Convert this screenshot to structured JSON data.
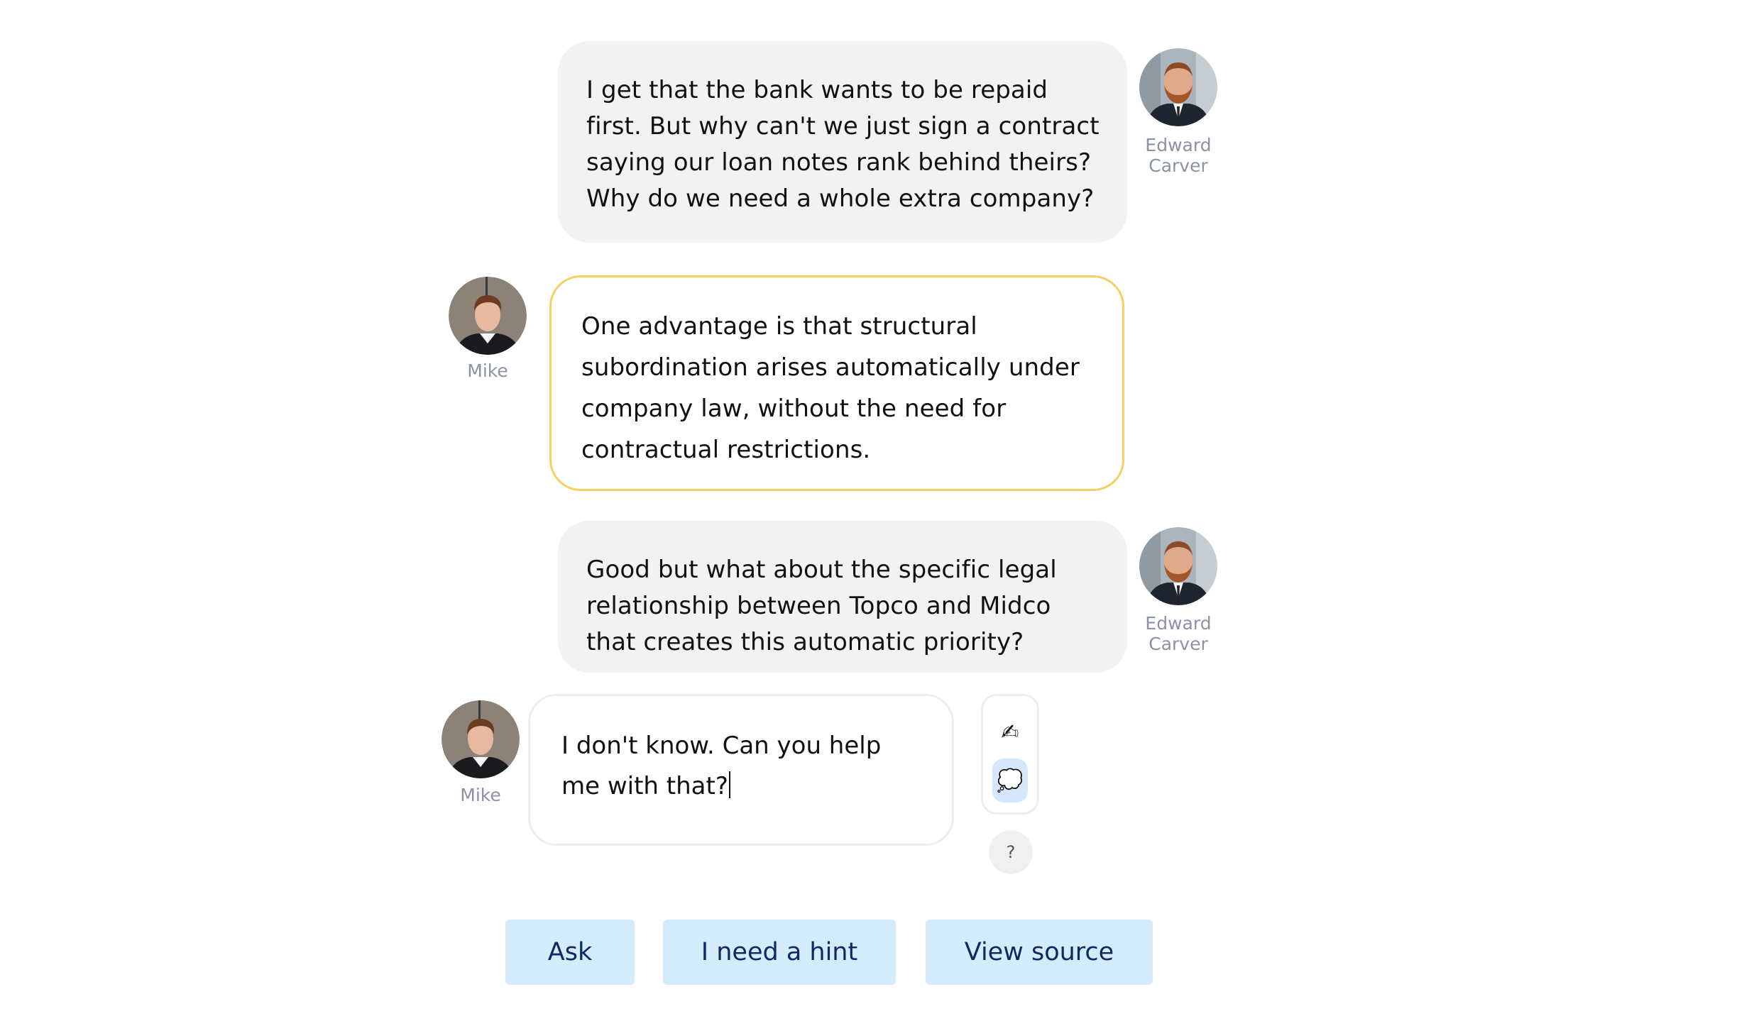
{
  "participants": {
    "interviewer": {
      "name": "Edward\nCarver",
      "name_line1": "Edward",
      "name_line2": "Carver"
    },
    "user": {
      "name": "Mike"
    }
  },
  "messages": [
    {
      "speaker": "Edward Carver",
      "text": "I get that the bank wants to be repaid first. But why can't we just sign a contract saying our loan notes rank behind theirs? Why do we need a whole extra company?"
    },
    {
      "speaker": "Mike",
      "text": "One advantage is that structural subordination arises automatically under company law, without the need for contractual restrictions."
    },
    {
      "speaker": "Edward Carver",
      "text": "Good but what about the specific legal relationship between Topco and Midco that creates this automatic priority?"
    }
  ],
  "composer": {
    "value": "I don't know. Can you help me with that?",
    "mode_icons": [
      "writing-hand-icon",
      "thought-bubble-icon"
    ],
    "active_mode": "thought-bubble-icon",
    "help_label": "?"
  },
  "actions": {
    "ask": "Ask",
    "hint": "I need a hint",
    "source": "View source"
  },
  "colors": {
    "highlight_border": "#f7cf63",
    "button_bg": "#d4ebfc",
    "button_text": "#0d2a63",
    "bubble_bg": "#f2f2f2"
  }
}
